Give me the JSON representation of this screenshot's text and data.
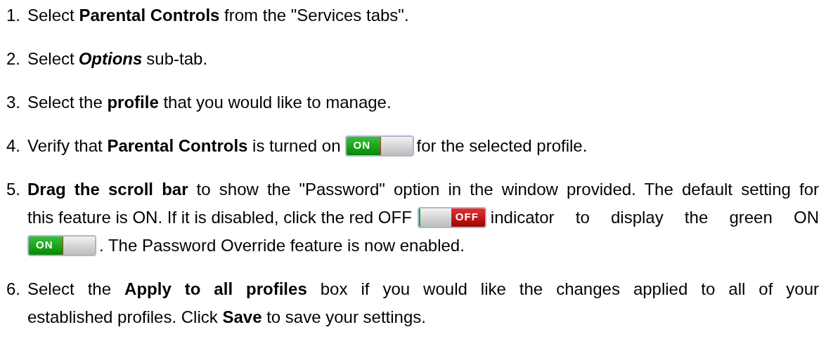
{
  "steps": [
    {
      "number": "1.",
      "lines": [
        [
          {
            "kind": "text",
            "text": "Select **Parental Controls** from the \"Services tabs\"."
          }
        ]
      ]
    },
    {
      "number": "2.",
      "lines": [
        [
          {
            "kind": "text",
            "text": "Select"
          },
          {
            "kind": "emphasis",
            "text": "Options"
          },
          {
            "kind": "text",
            "text": "sub-tab."
          }
        ]
      ]
    },
    {
      "number": "3.",
      "lines": [
        [
          {
            "kind": "text",
            "text": "Select the **profile** that you would like to manage."
          }
        ]
      ]
    },
    {
      "number": "4.",
      "lines": [
        [
          {
            "kind": "text",
            "text": "Verify that **Parental Controls** is turned on"
          },
          {
            "kind": "toggle",
            "on": true,
            "label": "ON"
          },
          {
            "kind": "text",
            "text": "for the selected profile."
          }
        ]
      ]
    },
    {
      "number": "5.",
      "lines": [
        [
          {
            "kind": "text",
            "text": "**Drag the scroll bar** to show the \"Password\" option in the window provided. The default setting for"
          }
        ],
        [
          {
            "kind": "text",
            "text": "this feature is ON. If it is disabled, click the red OFF"
          },
          {
            "kind": "toggle",
            "on": false,
            "label": "OFF"
          },
          {
            "kind": "text",
            "text": "indicator to display the green ON"
          }
        ],
        [
          {
            "kind": "toggle",
            "on": true,
            "label": "ON"
          },
          {
            "kind": "text",
            "text": ". The Password Override feature is now enabled."
          }
        ]
      ]
    },
    {
      "number": "6.",
      "lines": [
        [
          {
            "kind": "text",
            "text": "Select the **Apply to all profiles** box if you would like the changes applied to all of your"
          }
        ],
        [
          {
            "kind": "text",
            "text": "established profiles. Click **Save** to save your settings."
          }
        ]
      ]
    }
  ]
}
